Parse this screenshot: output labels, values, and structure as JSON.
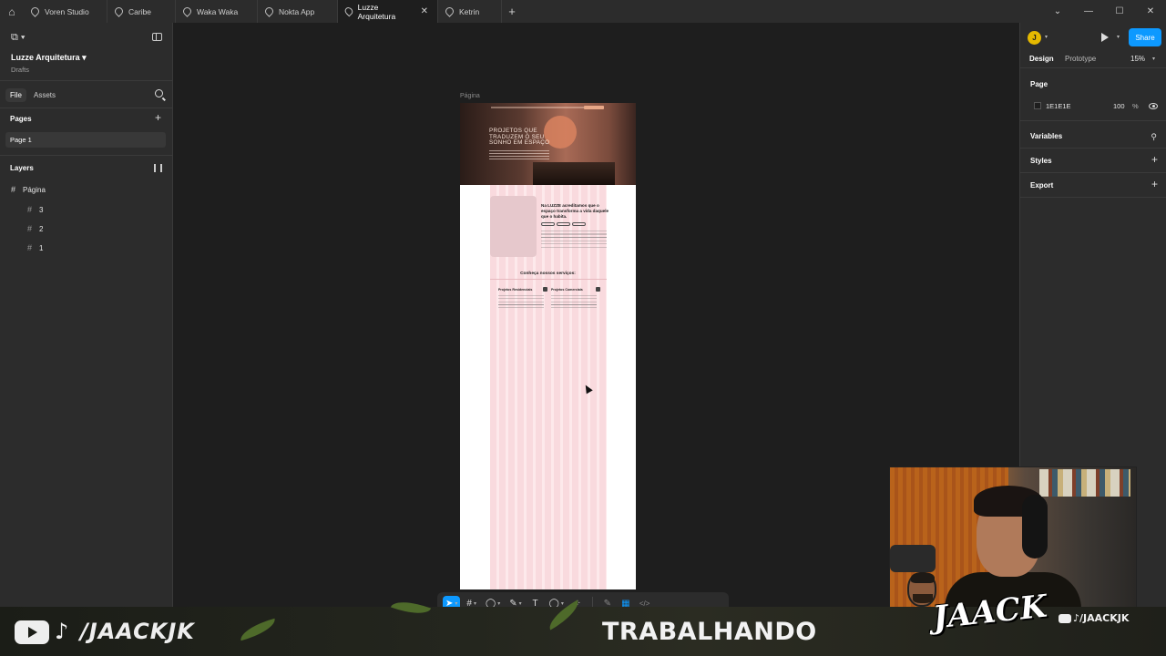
{
  "tabs": [
    {
      "label": "Voren Studio",
      "active": false
    },
    {
      "label": "Caribe",
      "active": false
    },
    {
      "label": "Waka Waka",
      "active": false
    },
    {
      "label": "Nokta App",
      "active": false
    },
    {
      "label": "Luzze Arquitetura",
      "active": true
    },
    {
      "label": "Ketrin",
      "active": false
    }
  ],
  "window_controls": {
    "chevron": "⌄",
    "minimize": "—",
    "maximize": "☐",
    "close": "✕"
  },
  "left_panel": {
    "project_title": "Luzze Arquitetura",
    "project_sub": "Drafts",
    "file_tab": "File",
    "assets_tab": "Assets",
    "pages_title": "Pages",
    "pages": [
      "Page 1"
    ],
    "layers_title": "Layers",
    "layers": [
      {
        "name": "Página",
        "level": 0
      },
      {
        "name": "3",
        "level": 1
      },
      {
        "name": "2",
        "level": 1
      },
      {
        "name": "1",
        "level": 1
      }
    ]
  },
  "canvas": {
    "frame_label": "Página",
    "hero_heading": "PROJETOS QUE TRADUZEM O SEU SONHO EM ESPAÇO",
    "about_heading": "Na LUZZE acreditamos que o espaço transforma a vida daquele que o habita.",
    "services_title": "Conheça nossos serviços:",
    "services": [
      {
        "title": "Projetos Residenciais"
      },
      {
        "title": "Projetos Comerciais"
      }
    ]
  },
  "toolbar": {
    "tools": [
      {
        "name": "move",
        "glyph": "➤",
        "active": true
      },
      {
        "name": "frame",
        "glyph": "#",
        "active": false
      },
      {
        "name": "shape",
        "glyph": "◯",
        "active": false
      },
      {
        "name": "pen",
        "glyph": "✎",
        "active": false
      },
      {
        "name": "text",
        "glyph": "T",
        "active": false
      },
      {
        "name": "comment",
        "glyph": "◯",
        "active": false
      },
      {
        "name": "components",
        "glyph": "⁘",
        "active": false
      }
    ],
    "modes": [
      {
        "name": "draw",
        "glyph": "✎"
      },
      {
        "name": "design",
        "glyph": "▦"
      },
      {
        "name": "dev",
        "glyph": "</>"
      }
    ]
  },
  "right_panel": {
    "avatar_letter": "J",
    "share_label": "Share",
    "design_tab": "Design",
    "prototype_tab": "Prototype",
    "zoom": "15%",
    "page_section": "Page",
    "bg_hex": "1E1E1E",
    "bg_opacity": "100",
    "percent": "%",
    "variables": "Variables",
    "styles": "Styles",
    "export": "Export"
  },
  "overlay": {
    "social_handle": "/JAACKJK",
    "status": "TRABALHANDO",
    "brand": "JAACK",
    "small_handle": "/JAACKJK"
  },
  "colors": {
    "accent": "#0d99ff",
    "canvas_bg": "#1e1e1e",
    "panel_bg": "#2c2c2c",
    "grid_column": "#f9dade"
  }
}
